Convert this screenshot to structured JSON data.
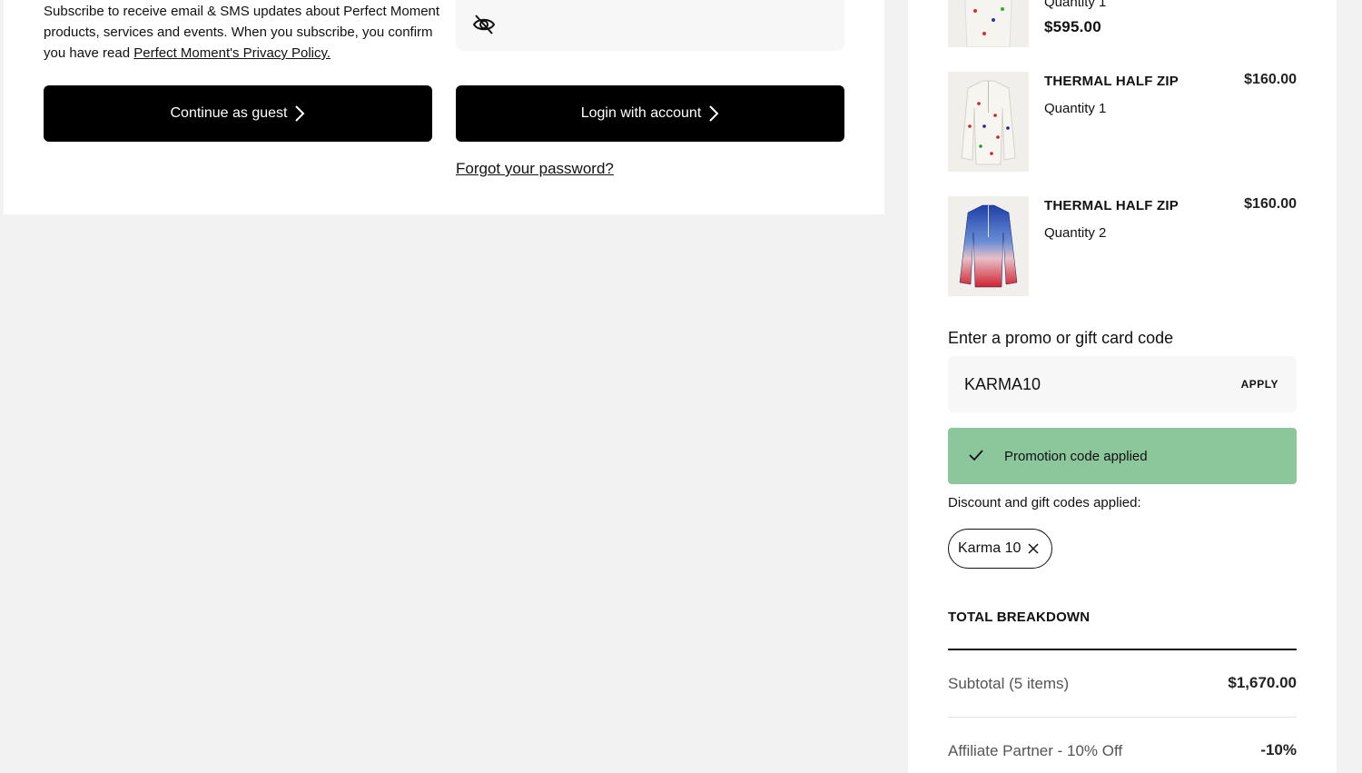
{
  "guest_section": {
    "subscribe_text": "Subscribe to receive email & SMS updates about Perfect Moment products, services and events. When you subscribe, you confirm you have read ",
    "privacy_link": "Perfect Moment's Privacy Policy.",
    "continue_guest_label": "Continue as guest",
    "login_label": "Login with account",
    "forgot_password": "Forgot your password?"
  },
  "cart": {
    "items": [
      {
        "qty": "Quantity 1",
        "price": "$595.00"
      },
      {
        "name": "THERMAL HALF ZIP",
        "qty": "Quantity 1",
        "price": "$160.00",
        "image": "white printed thermal half zip"
      },
      {
        "name": "THERMAL HALF ZIP",
        "qty": "Quantity 2",
        "price": "$160.00",
        "image": "blue to red gradient thermal half zip"
      }
    ],
    "promo": {
      "label": "Enter a promo or gift card code",
      "value": "KARMA10",
      "apply_label": "APPLY",
      "success_message": "Promotion code applied",
      "applied_label": "Discount and gift codes applied:",
      "chip_label": "Karma 10"
    },
    "total": {
      "heading": "TOTAL BREAKDOWN",
      "subtotal_label": "Subtotal (5 items)",
      "subtotal_value": "$1,670.00",
      "discount_label": "Affiliate Partner - 10% Off",
      "discount_value": "-10%"
    }
  },
  "colors": {
    "success_green": "#8bc79a",
    "button_black": "#000000"
  }
}
